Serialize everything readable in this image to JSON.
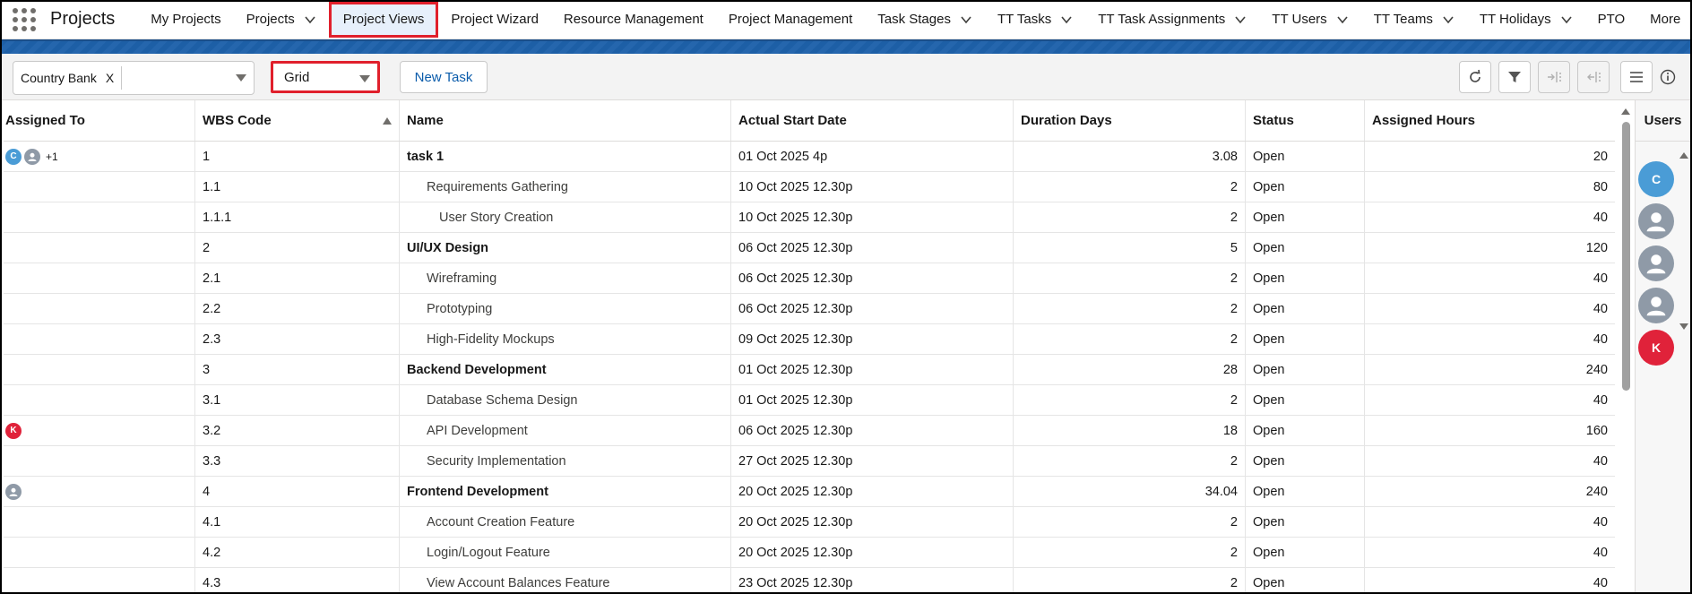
{
  "app": {
    "name": "Projects"
  },
  "nav": {
    "items": [
      {
        "label": "My Projects",
        "chevron": false,
        "active": false
      },
      {
        "label": "Projects",
        "chevron": true,
        "active": false
      },
      {
        "label": "Project Views",
        "chevron": false,
        "active": true
      },
      {
        "label": "Project Wizard",
        "chevron": false,
        "active": false
      },
      {
        "label": "Resource Management",
        "chevron": false,
        "active": false
      },
      {
        "label": "Project Management",
        "chevron": false,
        "active": false
      },
      {
        "label": "Task Stages",
        "chevron": true,
        "active": false
      },
      {
        "label": "TT Tasks",
        "chevron": true,
        "active": false
      },
      {
        "label": "TT Task Assignments",
        "chevron": true,
        "active": false
      },
      {
        "label": "TT Users",
        "chevron": true,
        "active": false
      },
      {
        "label": "TT Teams",
        "chevron": true,
        "active": false
      },
      {
        "label": "TT Holidays",
        "chevron": true,
        "active": false
      },
      {
        "label": "PTO",
        "chevron": false,
        "active": false
      },
      {
        "label": "More",
        "chevron": true,
        "active": false
      }
    ]
  },
  "toolbar": {
    "project_pill": "Country Bank",
    "pill_remove": "X",
    "view_value": "Grid",
    "new_task_label": "New Task"
  },
  "grid": {
    "columns": [
      "Assigned To",
      "WBS Code",
      "Name",
      "Actual Start Date",
      "Duration Days",
      "Status",
      "Assigned Hours"
    ],
    "rows": [
      {
        "assigned": [
          "C",
          "user",
          "+1"
        ],
        "wbs": "1",
        "name": "task 1",
        "level": 0,
        "start": "01 Oct 2025 4p",
        "duration": "3.08",
        "status": "Open",
        "hours": "20"
      },
      {
        "assigned": [],
        "wbs": "1.1",
        "name": "Requirements Gathering",
        "level": 1,
        "start": "10 Oct 2025 12.30p",
        "duration": "2",
        "status": "Open",
        "hours": "80"
      },
      {
        "assigned": [],
        "wbs": "1.1.1",
        "name": "User Story Creation",
        "level": 2,
        "start": "10 Oct 2025 12.30p",
        "duration": "2",
        "status": "Open",
        "hours": "40"
      },
      {
        "assigned": [],
        "wbs": "2",
        "name": "UI/UX Design",
        "level": 0,
        "start": "06 Oct 2025 12.30p",
        "duration": "5",
        "status": "Open",
        "hours": "120"
      },
      {
        "assigned": [],
        "wbs": "2.1",
        "name": "Wireframing",
        "level": 1,
        "start": "06 Oct 2025 12.30p",
        "duration": "2",
        "status": "Open",
        "hours": "40"
      },
      {
        "assigned": [],
        "wbs": "2.2",
        "name": "Prototyping",
        "level": 1,
        "start": "06 Oct 2025 12.30p",
        "duration": "2",
        "status": "Open",
        "hours": "40"
      },
      {
        "assigned": [],
        "wbs": "2.3",
        "name": "High-Fidelity Mockups",
        "level": 1,
        "start": "09 Oct 2025 12.30p",
        "duration": "2",
        "status": "Open",
        "hours": "40"
      },
      {
        "assigned": [],
        "wbs": "3",
        "name": "Backend Development",
        "level": 0,
        "start": "01 Oct 2025 12.30p",
        "duration": "28",
        "status": "Open",
        "hours": "240"
      },
      {
        "assigned": [],
        "wbs": "3.1",
        "name": "Database Schema Design",
        "level": 1,
        "start": "01 Oct 2025 12.30p",
        "duration": "2",
        "status": "Open",
        "hours": "40"
      },
      {
        "assigned": [
          "K"
        ],
        "wbs": "3.2",
        "name": "API Development",
        "level": 1,
        "start": "06 Oct 2025 12.30p",
        "duration": "18",
        "status": "Open",
        "hours": "160"
      },
      {
        "assigned": [],
        "wbs": "3.3",
        "name": "Security Implementation",
        "level": 1,
        "start": "27 Oct 2025 12.30p",
        "duration": "2",
        "status": "Open",
        "hours": "40"
      },
      {
        "assigned": [
          "user"
        ],
        "wbs": "4",
        "name": "Frontend Development",
        "level": 0,
        "start": "20 Oct 2025 12.30p",
        "duration": "34.04",
        "status": "Open",
        "hours": "240"
      },
      {
        "assigned": [],
        "wbs": "4.1",
        "name": "Account Creation Feature",
        "level": 1,
        "start": "20 Oct 2025 12.30p",
        "duration": "2",
        "status": "Open",
        "hours": "40"
      },
      {
        "assigned": [],
        "wbs": "4.2",
        "name": "Login/Logout Feature",
        "level": 1,
        "start": "20 Oct 2025 12.30p",
        "duration": "2",
        "status": "Open",
        "hours": "40"
      },
      {
        "assigned": [],
        "wbs": "4.3",
        "name": "View Account Balances Feature",
        "level": 1,
        "start": "23 Oct 2025 12.30p",
        "duration": "2",
        "status": "Open",
        "hours": "40"
      }
    ]
  },
  "users_panel": {
    "title": "Users",
    "avatars": [
      "C",
      "user",
      "user",
      "user",
      "K"
    ]
  },
  "colors": {
    "active_highlight": "#e0202c",
    "link": "#0b5cab",
    "avatar_c": "#4a9cd6",
    "avatar_k": "#e0223a",
    "avatar_default": "#8f9aa7",
    "banner": "#1d5fa6"
  },
  "icons": {
    "toolbar": [
      "refresh-icon",
      "filter-icon",
      "collapse-columns-icon",
      "expand-columns-icon",
      "menu-icon",
      "info-icon"
    ]
  }
}
